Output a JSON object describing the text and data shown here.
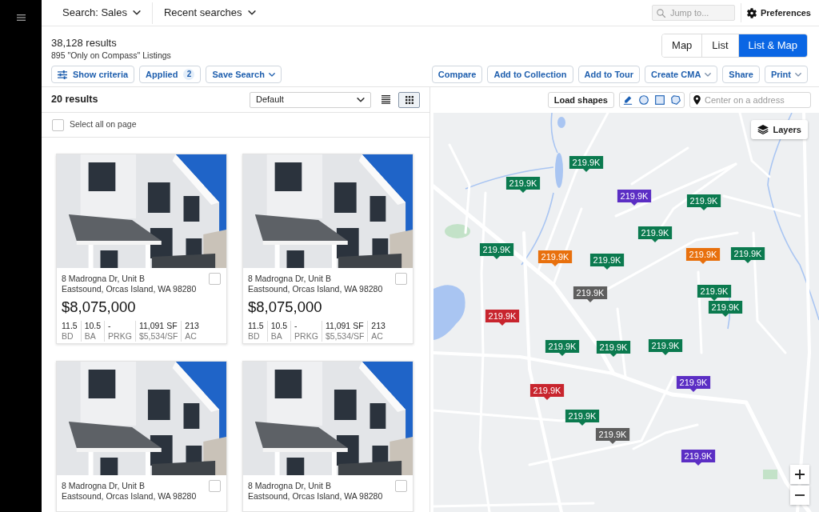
{
  "top_bar": {
    "menus": [
      {
        "label": "Search: Sales"
      },
      {
        "label": "Recent searches"
      }
    ],
    "search": {
      "placeholder": "Jump to..."
    },
    "preferences": {
      "label": "Preferences"
    }
  },
  "summary": {
    "title": "38,128 results",
    "subtitle": "895 \"Only on Compass\" Listings",
    "view_modes": [
      {
        "label": "Map",
        "selected": false
      },
      {
        "label": "List",
        "selected": false
      },
      {
        "label": "List & Map",
        "selected": true
      }
    ],
    "filter_buttons": [
      {
        "kind": "icon",
        "label": "Show criteria"
      },
      {
        "kind": "count",
        "label": "Applied",
        "count": "2"
      },
      {
        "kind": "dropdown",
        "label": "Save Search"
      }
    ],
    "action_buttons": [
      {
        "kind": "plain",
        "label": "Compare"
      },
      {
        "kind": "plain",
        "label": "Add to Collection"
      },
      {
        "kind": "plain",
        "label": "Add to Tour"
      },
      {
        "kind": "dropdown",
        "label": "Create CMA"
      },
      {
        "kind": "plain",
        "label": "Share"
      },
      {
        "kind": "dropdown",
        "label": "Print"
      }
    ]
  },
  "list_panel": {
    "count": "20 results",
    "sort": {
      "value": "Default"
    },
    "layouts": [
      {
        "kind": "list",
        "selected": false
      },
      {
        "kind": "grid",
        "selected": true
      }
    ],
    "select_all": {
      "label": "Select all on page",
      "checked": false
    },
    "listings": [
      {
        "address_line_1": "8 Madrogna Dr, Unit B",
        "address_line_2": "Eastsound, Orcas Island, WA 98280",
        "checked": false,
        "price": "$8,075,000",
        "stats": [
          {
            "value": "11.5",
            "label": "BD"
          },
          {
            "value": "10.5",
            "label": "BA"
          },
          {
            "value": "-",
            "label": "PRKG"
          },
          {
            "value": "11,091 SF",
            "label": "$5,534/SF"
          },
          {
            "value": "213",
            "label": "AC"
          }
        ]
      },
      {
        "address_line_1": "8 Madrogna Dr, Unit B",
        "address_line_2": "Eastsound, Orcas Island, WA 98280",
        "checked": false,
        "price": "$8,075,000",
        "stats": [
          {
            "value": "11.5",
            "label": "BD"
          },
          {
            "value": "10.5",
            "label": "BA"
          },
          {
            "value": "-",
            "label": "PRKG"
          },
          {
            "value": "11,091 SF",
            "label": "$5,534/SF"
          },
          {
            "value": "213",
            "label": "AC"
          }
        ]
      },
      {
        "address_line_1": "8 Madrogna Dr, Unit B",
        "address_line_2": "Eastsound, Orcas Island, WA 98280",
        "checked": false
      },
      {
        "address_line_1": "8 Madrogna Dr, Unit B",
        "address_line_2": "Eastsound, Orcas Island, WA 98280",
        "checked": false
      }
    ]
  },
  "map": {
    "load_shapes": "Load shapes",
    "address_search": {
      "placeholder": "Center on a address"
    },
    "layers": "Layers",
    "markers": [
      {
        "label": "219.9K",
        "color": "#0b7a4f"
      },
      {
        "label": "219.9K",
        "color": "#0b7a4f"
      },
      {
        "label": "219.9K",
        "color": "#5b2ec4"
      },
      {
        "label": "219.9K",
        "color": "#0b7a4f"
      },
      {
        "label": "219.9K",
        "color": "#0b7a4f"
      },
      {
        "label": "219.9K",
        "color": "#0b7a4f"
      },
      {
        "label": "219.9K",
        "color": "#e8700d"
      },
      {
        "label": "219.9K",
        "color": "#0b7a4f"
      },
      {
        "label": "219.9K",
        "color": "#e8700d"
      },
      {
        "label": "219.9K",
        "color": "#0b7a4f"
      },
      {
        "label": "219.9K",
        "color": "#5e5e5e"
      },
      {
        "label": "219.9K",
        "color": "#0b7a4f"
      },
      {
        "label": "219.9K",
        "color": "#0b7a4f"
      },
      {
        "label": "219.9K",
        "color": "#c8252e"
      },
      {
        "label": "219.9K",
        "color": "#0b7a4f"
      },
      {
        "label": "219.9K",
        "color": "#0b7a4f"
      },
      {
        "label": "219.9K",
        "color": "#0b7a4f"
      },
      {
        "label": "219.9K",
        "color": "#5b2ec4"
      },
      {
        "label": "219.9K",
        "color": "#c8252e"
      },
      {
        "label": "219.9K",
        "color": "#0b7a4f"
      },
      {
        "label": "219.9K",
        "color": "#5e5e5e"
      },
      {
        "label": "219.9K",
        "color": "#5b2ec4"
      }
    ]
  }
}
